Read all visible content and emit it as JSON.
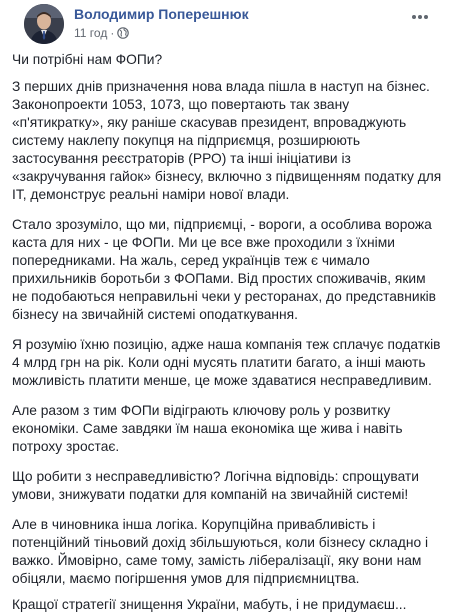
{
  "post": {
    "author": "Володимир Поперешнюк",
    "time": "11 год",
    "separator": "·",
    "privacy_icon": "globe-icon",
    "menu_icon": "more-icon",
    "paragraphs": [
      "Чи потрібні нам ФОПи?",
      "З перших днів призначення нова влада пішла в наступ на бізнес. Законопроекти 1053, 1073, що повертають так звану «п'ятикратку», яку раніше скасував президент, впроваджують систему наклепу покупця на підприємця, розширюють застосування реєстраторів (РРО) та інші ініціативи із «закручування гайок» бізнесу, включно з підвищенням податку для ІТ, демонструє реальні наміри нової влади.",
      "Стало зрозуміло, що ми, підприємці, - вороги, а особлива ворожа каста для них - це ФОПи. Ми це все вже проходили з їхніми попередниками. На жаль, серед українців теж є чимало прихильників боротьби з ФОПами. Від простих споживачів, яким не подобаються неправильні чеки у ресторанах, до представників бізнесу на звичайній системі оподаткування.",
      "Я розумію їхню позицію, адже наша компанія теж сплачує податків 4 млрд грн на рік. Коли одні мусять платити багато, а інші мають можливість платити менше, це може здаватися несправедливим.",
      "Але разом з тим ФОПи відіграють ключову роль у розвитку економіки. Саме завдяки їм наша економіка ще жива і навіть потроху зростає.",
      "Що робити з несправедливістю? Логічна відповідь: спрощувати умови, знижувати податки для компаній на звичайній системі!",
      "Але в чиновника інша логіка. Корупційна привабливість і потенційний тіньовий дохід збільшуються, коли бізнесу складно і важко. Ймовірно, саме тому, замість лібералізації, яку вони нам обіцяли, маємо погіршення умов для підприємництва.",
      "Кращої стратегії знищення України, мабуть, і не придумаєш..."
    ]
  }
}
